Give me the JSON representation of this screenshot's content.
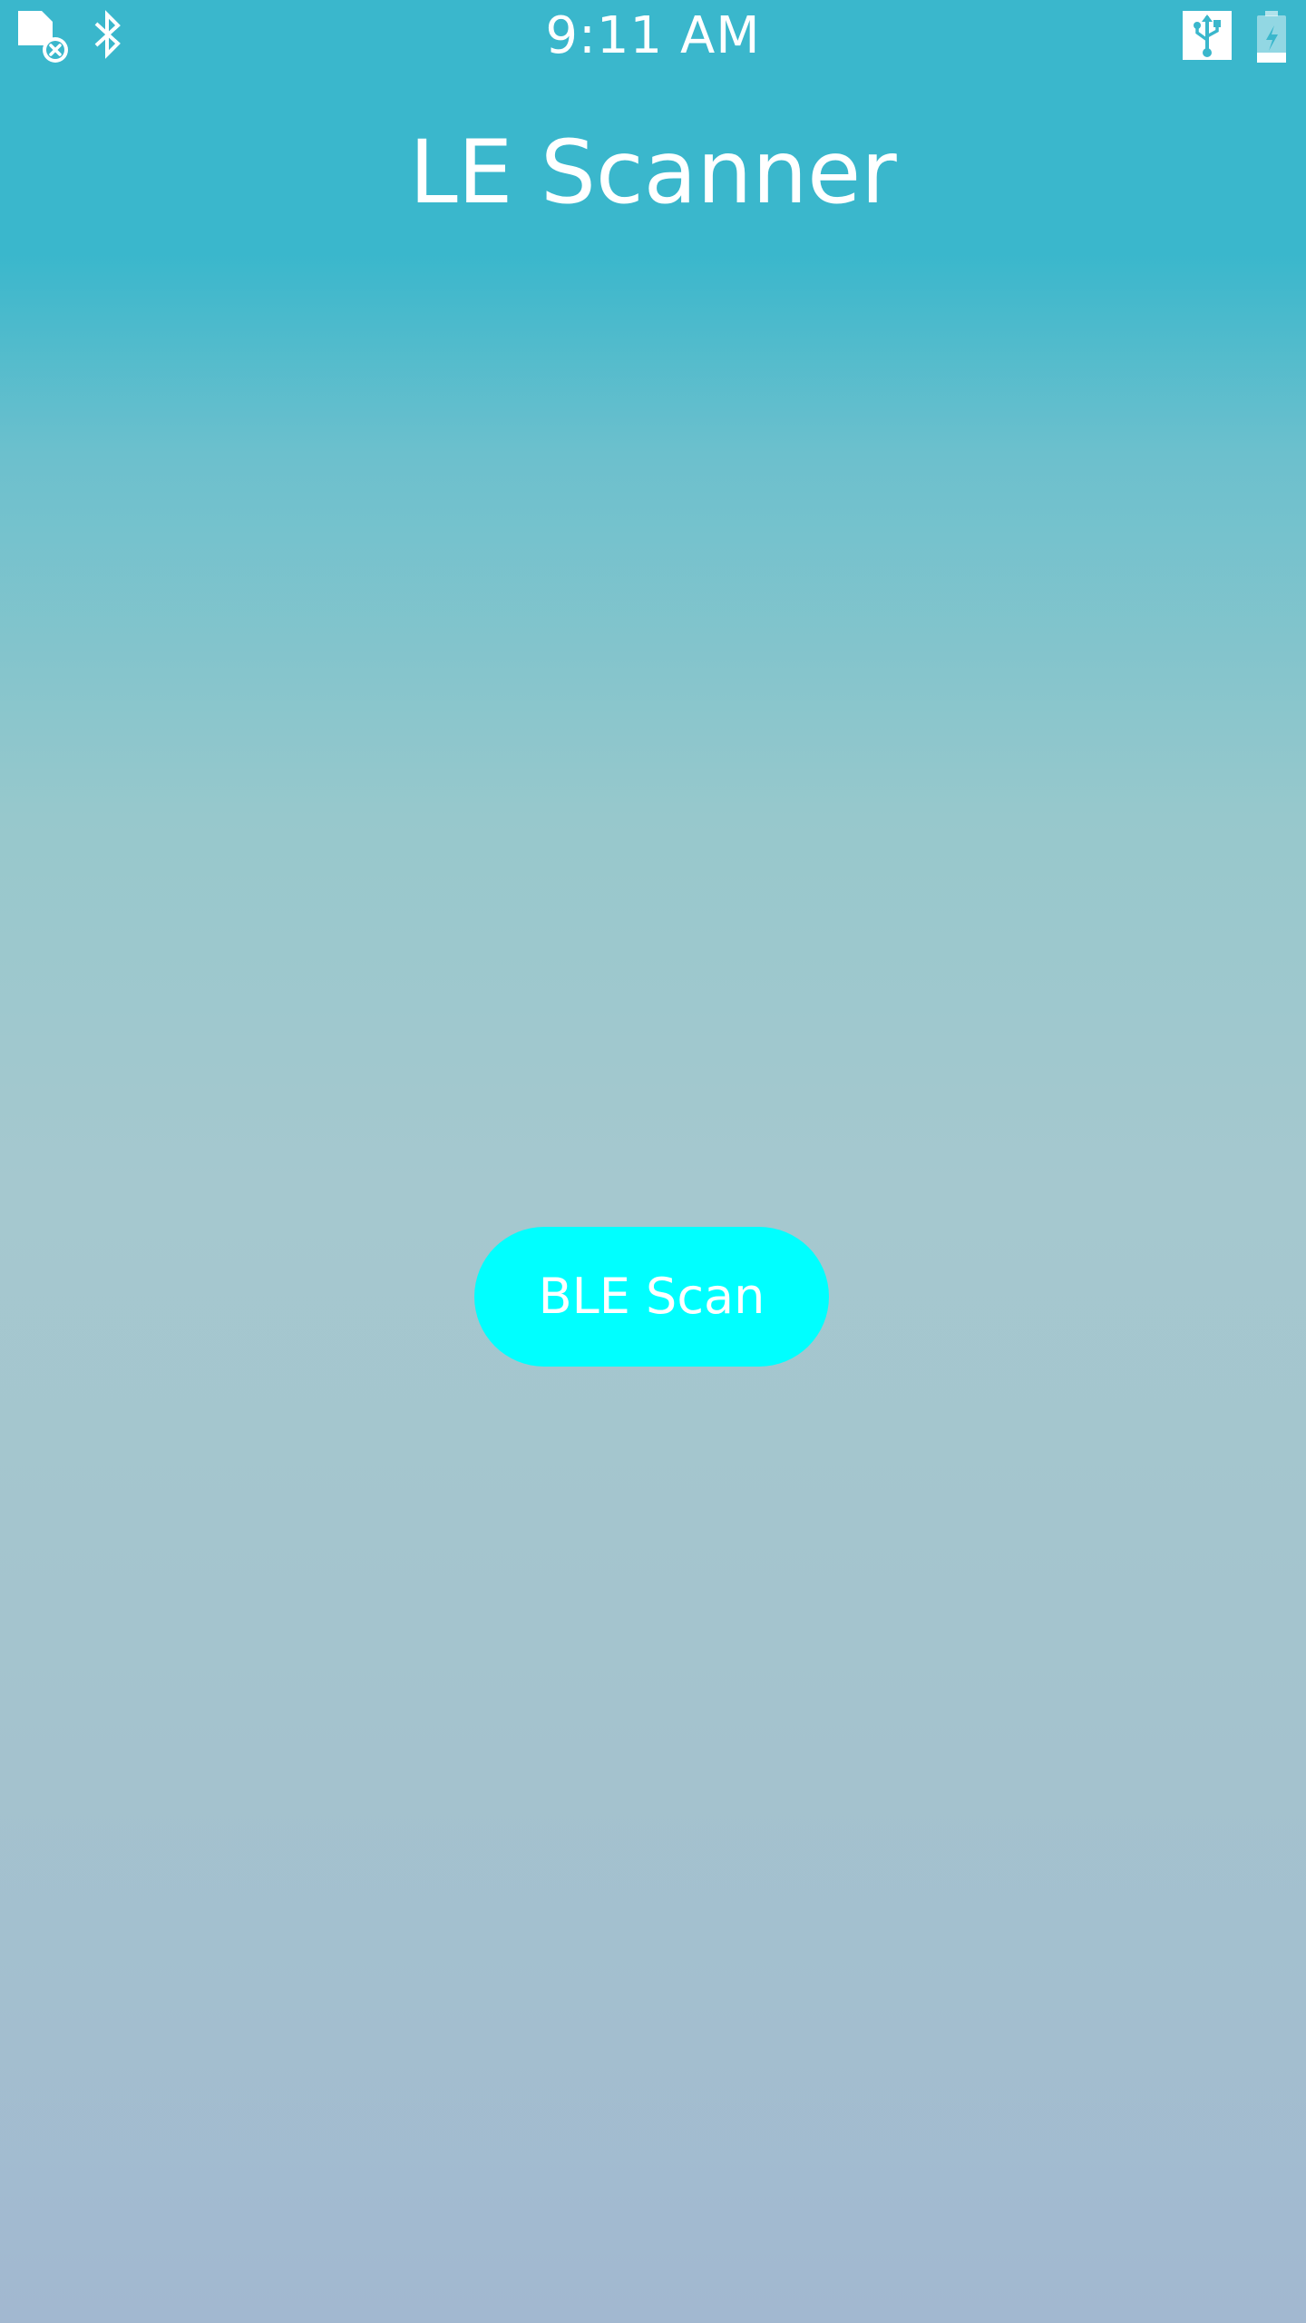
{
  "status_bar": {
    "time": "9:11 AM",
    "icons": [
      "sim-card-error-icon",
      "bluetooth-icon",
      "usb-icon",
      "battery-charging-icon"
    ]
  },
  "app": {
    "title": "LE Scanner"
  },
  "main": {
    "scan_button_label": "BLE Scan"
  },
  "colors": {
    "header_teal": "#3ab7cc",
    "bottom_gradient": "#a2b8d0",
    "button_cyan": "#00ffff",
    "text": "#ffffff"
  }
}
